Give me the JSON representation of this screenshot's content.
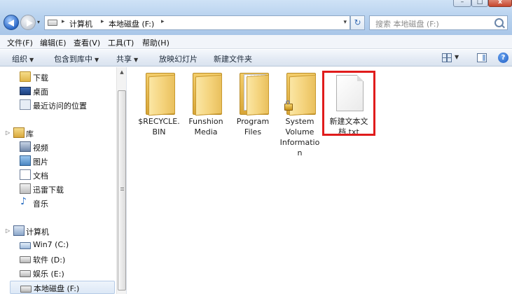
{
  "address": {
    "breadcrumbs": [
      "计算机",
      "本地磁盘 (F:)"
    ]
  },
  "search": {
    "placeholder": "搜索 本地磁盘 (F:)"
  },
  "menu": [
    "文件(F)",
    "编辑(E)",
    "查看(V)",
    "工具(T)",
    "帮助(H)"
  ],
  "toolbar": {
    "organize": "组织",
    "include_library": "包含到库中",
    "share": "共享",
    "slideshow": "放映幻灯片",
    "new_folder": "新建文件夹",
    "help": "?"
  },
  "nav": {
    "favorites": [
      "下载",
      "桌面",
      "最近访问的位置"
    ],
    "libraries_header": "库",
    "libraries": [
      "视频",
      "图片",
      "文档",
      "迅雷下载",
      "音乐"
    ],
    "computer_header": "计算机",
    "drives": [
      "Win7 (C:)",
      "软件 (D:)",
      "娱乐 (E:)",
      "本地磁盘 (F:)"
    ]
  },
  "files": [
    {
      "name_line1": "$RECYCLE.",
      "name_line2": "BIN",
      "name_line3": "",
      "name_line4": "",
      "type": "folder"
    },
    {
      "name_line1": "Funshion",
      "name_line2": "Media",
      "name_line3": "",
      "name_line4": "",
      "type": "folder"
    },
    {
      "name_line1": "Program",
      "name_line2": "Files",
      "name_line3": "",
      "name_line4": "",
      "type": "folder"
    },
    {
      "name_line1": "System",
      "name_line2": "Volume",
      "name_line3": "Informatio",
      "name_line4": "n",
      "type": "folder-locked"
    },
    {
      "name_line1": "新建文本文",
      "name_line2": "档.txt",
      "name_line3": "",
      "name_line4": "",
      "type": "text-file"
    }
  ],
  "colors": {
    "highlight": "#e01c1c",
    "accent": "#2a68c8"
  }
}
